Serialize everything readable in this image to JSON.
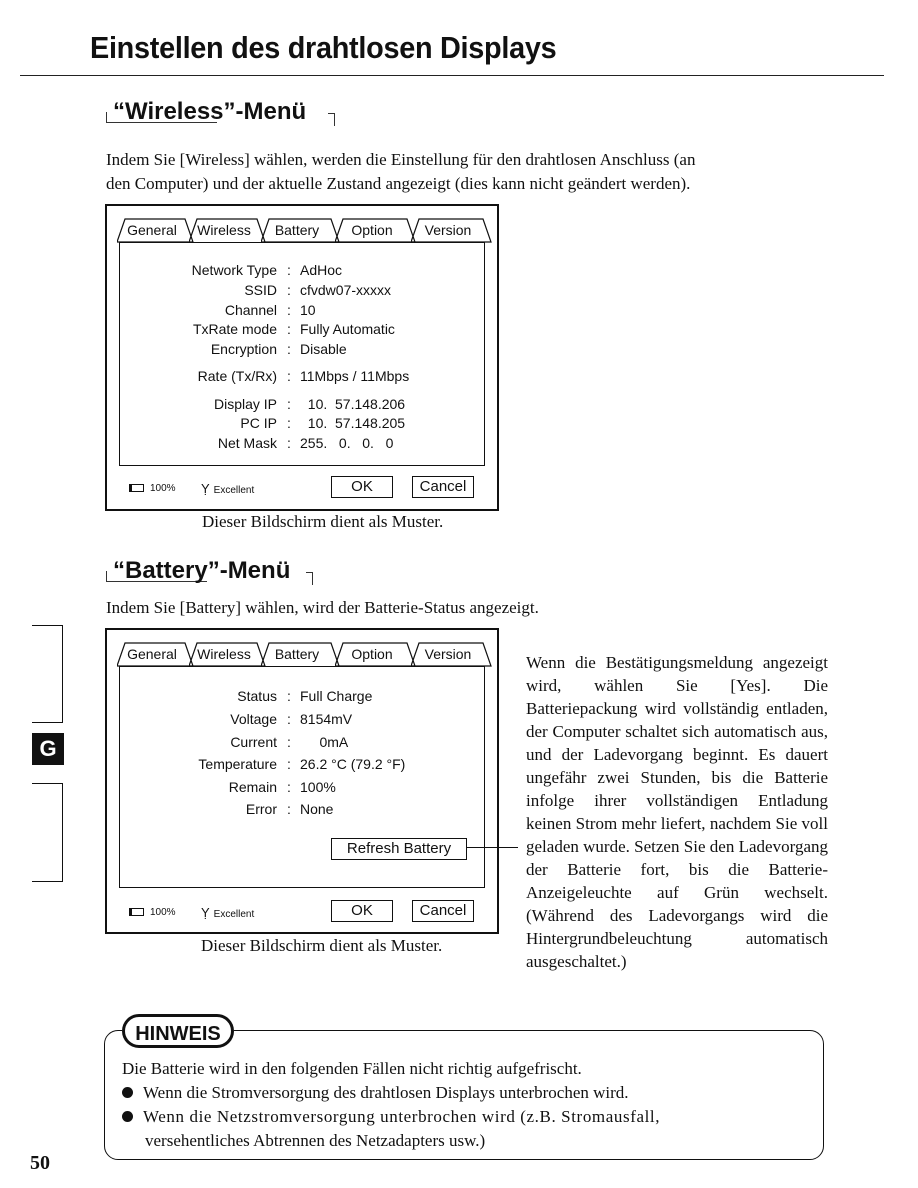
{
  "page": {
    "title": "Einstellen des drahtlosen Displays",
    "page_number": "50",
    "side_tab_letter": "G"
  },
  "wireless_section": {
    "heading": "“Wireless”-Menü",
    "intro_line1": "Indem Sie [Wireless] wählen, werden die Einstellung für den drahtlosen Anschluss (an",
    "intro_line2": "den Computer) und der aktuelle Zustand angezeigt (dies kann nicht geändert werden).",
    "dialog": {
      "tabs": [
        "General",
        "Wireless",
        "Battery",
        "Option",
        "Version"
      ],
      "active_tab": "Wireless",
      "fields": [
        {
          "label": "Network Type",
          "value": "AdHoc"
        },
        {
          "label": "SSID",
          "value": "cfvdw07-xxxxx"
        },
        {
          "label": "Channel",
          "value": "10"
        },
        {
          "label": "TxRate mode",
          "value": "Fully Automatic"
        },
        {
          "label": "Encryption",
          "value": "Disable"
        },
        {
          "label": "Rate (Tx/Rx)",
          "value": "11Mbps / 11Mbps"
        },
        {
          "label": "Display IP",
          "value": "  10.  57.148.206"
        },
        {
          "label": "PC IP",
          "value": "  10.  57.148.205"
        },
        {
          "label": "Net Mask",
          "value": "255.   0.   0.   0"
        }
      ],
      "battery_status": "100%",
      "signal_status": "Excellent",
      "ok_label": "OK",
      "cancel_label": "Cancel"
    },
    "caption": "Dieser Bildschirm dient als Muster."
  },
  "battery_section": {
    "heading": "“Battery”-Menü",
    "intro": "Indem Sie [Battery] wählen, wird der Batterie-Status angezeigt.",
    "dialog": {
      "tabs": [
        "General",
        "Wireless",
        "Battery",
        "Option",
        "Version"
      ],
      "active_tab": "Battery",
      "fields": [
        {
          "label": "Status",
          "value": "Full Charge"
        },
        {
          "label": "Voltage",
          "value": "8154mV"
        },
        {
          "label": "Current",
          "value": "     0mA"
        },
        {
          "label": "Temperature",
          "value": "26.2 °C (79.2 °F)"
        },
        {
          "label": "Remain",
          "value": "100%"
        },
        {
          "label": "Error",
          "value": "None"
        }
      ],
      "refresh_label": "Refresh Battery",
      "battery_status": "100%",
      "signal_status": "Excellent",
      "ok_label": "OK",
      "cancel_label": "Cancel"
    },
    "caption": "Dieser Bildschirm dient als Muster.",
    "side_note": "Wenn die Bestätigungsmeldung angezeigt wird, wählen Sie [Yes]. Die Batteriepackung wird vollständig entladen, der Computer schaltet sich automatisch aus, und der Ladevorgang beginnt. Es dauert ungefähr zwei Stunden, bis die Batterie infolge ihrer vollständigen Entladung keinen Strom mehr liefert, nachdem Sie voll geladen wurde. Setzen Sie den Ladevorgang der Batterie fort, bis die Batterie-Anzeigeleuchte auf Grün wechselt. (Während des Ladevorgangs wird die Hintergrundbeleuchtung automatisch ausgeschaltet.)"
  },
  "hinweis": {
    "label": "HINWEIS",
    "intro": "Die Batterie wird in den folgenden Fällen nicht richtig aufgefrischt.",
    "bullets": [
      "Wenn die Stromversorgung des drahtlosen Displays unterbrochen wird.",
      "Wenn die Netzstromversorgung unterbrochen wird (z.B. Stromausfall,",
      "versehentliches Abtrennen des Netzadapters usw.)"
    ]
  }
}
